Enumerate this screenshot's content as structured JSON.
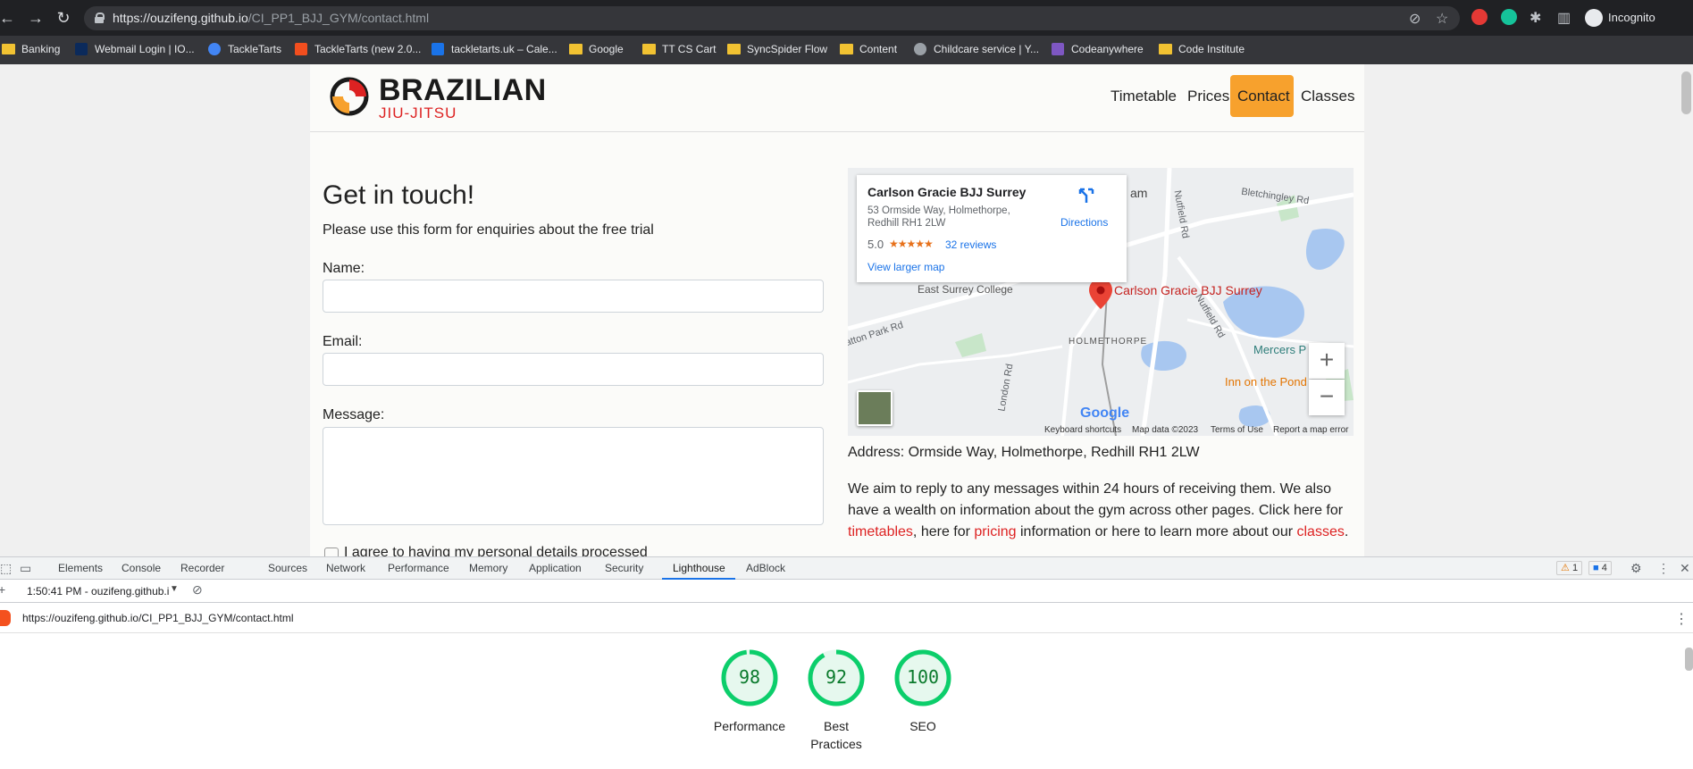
{
  "browser": {
    "url_host": "https://ouzifeng.github.io",
    "url_path": "/CI_PP1_BJJ_GYM/contact.html",
    "profile_label": "Incognito"
  },
  "bookmarks": [
    {
      "label": "Banking",
      "icon": "folder-icon"
    },
    {
      "label": "Webmail Login | IO...",
      "icon": "webmail-icon"
    },
    {
      "label": "TackleTarts",
      "icon": "tackletarts-icon"
    },
    {
      "label": "TackleTarts (new 2.0...",
      "icon": "figma-icon"
    },
    {
      "label": "tackletarts.uk – Cale...",
      "icon": "calendar-icon"
    },
    {
      "label": "Google",
      "icon": "folder-icon"
    },
    {
      "label": "TT CS Cart",
      "icon": "folder-icon"
    },
    {
      "label": "SyncSpider Flow",
      "icon": "folder-icon"
    },
    {
      "label": "Content",
      "icon": "folder-icon"
    },
    {
      "label": "Childcare service | Y...",
      "icon": "globe-icon"
    },
    {
      "label": "Codeanywhere",
      "icon": "codeanywhere-icon"
    },
    {
      "label": "Code Institute",
      "icon": "folder-icon"
    }
  ],
  "site": {
    "logo_main": "BRAZILIAN",
    "logo_sub": "JIU-JITSU",
    "nav": [
      "Timetable",
      "Prices",
      "Contact",
      "Classes"
    ],
    "active_nav": "Contact",
    "accent_color": "#f7a12d",
    "link_color": "#d22222"
  },
  "form": {
    "title": "Get in touch!",
    "lead": "Please use this form for enquiries about the free trial",
    "name_label": "Name:",
    "email_label": "Email:",
    "message_label": "Message:",
    "consent_label": "I agree to having my personal details processed"
  },
  "map": {
    "place_name": "Carlson Gracie BJJ Surrey",
    "address_line1": "53 Ormside Way, Holmethorpe,",
    "address_line2": "Redhill RH1 2LW",
    "rating": "5.0",
    "stars": "★★★★★",
    "reviews": "32 reviews",
    "directions": "Directions",
    "larger_map": "View larger map",
    "labels": {
      "am": "am",
      "bletchingley": "Bletchingley Rd",
      "nutfield1": "Nutfield Rd",
      "nutfield2": "Nutfield Rd",
      "college": "East Surrey College",
      "holmethorpe": "HOLMETHORPE",
      "mercers": "Mercers P",
      "inn": "Inn on the Pond",
      "london_rd": "London Rd",
      "hatton": "atton Park Rd",
      "pin_label": "Carlson Gracie BJJ Surrey"
    },
    "zoom_in": "+",
    "zoom_out": "−",
    "google": "Google",
    "footer": [
      "Keyboard shortcuts",
      "Map data ©2023",
      "Terms of Use",
      "Report a map error"
    ]
  },
  "contact": {
    "address": "Address: Ormside Way, Holmethorpe, Redhill RH1 2LW",
    "para_1": "We aim to reply to any messages within 24 hours of receiving them. We also have a wealth on information about the gym across other pages. Click here for ",
    "link_timetables": "timetables",
    "para_2": ", here for ",
    "link_pricing": "pricing",
    "para_3": " information or here to learn more about our ",
    "link_classes": "classes",
    "para_4": "."
  },
  "devtools": {
    "tabs": [
      "Elements",
      "Console",
      "Recorder",
      "Sources",
      "Network",
      "Performance",
      "Memory",
      "Application",
      "Security",
      "Lighthouse",
      "AdBlock"
    ],
    "active_tab": "Lighthouse",
    "warnings": "1",
    "messages": "4",
    "report_selector": "1:50:41 PM - ouzifeng.github.i",
    "report_url": "https://ouzifeng.github.io/CI_PP1_BJJ_GYM/contact.html",
    "scores": [
      {
        "label": "Performance",
        "value": 98
      },
      {
        "label": "Best Practices",
        "value": 92
      },
      {
        "label": "SEO",
        "value": 100
      }
    ],
    "score_color": "#0cce6b"
  }
}
